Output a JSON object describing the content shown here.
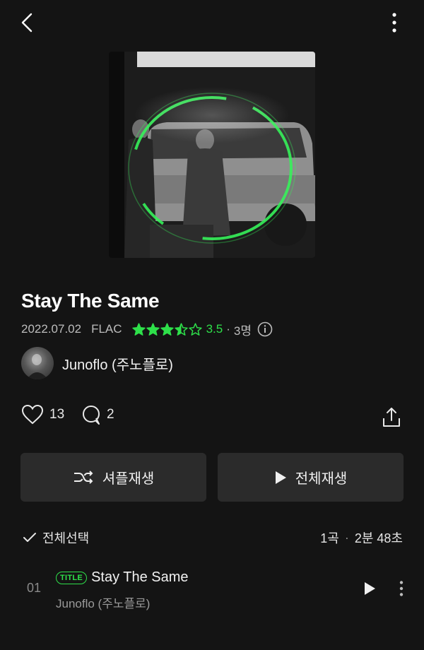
{
  "header": {
    "back_icon": "chevron-left-icon",
    "more_icon": "more-vertical-icon"
  },
  "album": {
    "cover_icon": "album-cover-image",
    "title": "Stay The Same",
    "date": "2022.07.02",
    "format": "FLAC",
    "rating": 3.5,
    "rating_text": "3.5",
    "rating_sep": "·",
    "rating_count": "3명",
    "rating_color": "#2ee04a",
    "artist": "Junoflo (주노플로)"
  },
  "stats": {
    "likes": "13",
    "comments": "2"
  },
  "buttons": {
    "shuffle_label": "셔플재생",
    "play_all_label": "전체재생"
  },
  "list": {
    "select_all_label": "전체선택",
    "count_label": "1곡",
    "dot": "·",
    "duration_label": "2분 48초"
  },
  "tracks": [
    {
      "number": "01",
      "badge": "TITLE",
      "title": "Stay The Same",
      "artist": "Junoflo (주노플로)"
    }
  ],
  "colors": {
    "background": "#141414",
    "accent": "#2ee04a",
    "button_bg": "#2b2b2b"
  }
}
